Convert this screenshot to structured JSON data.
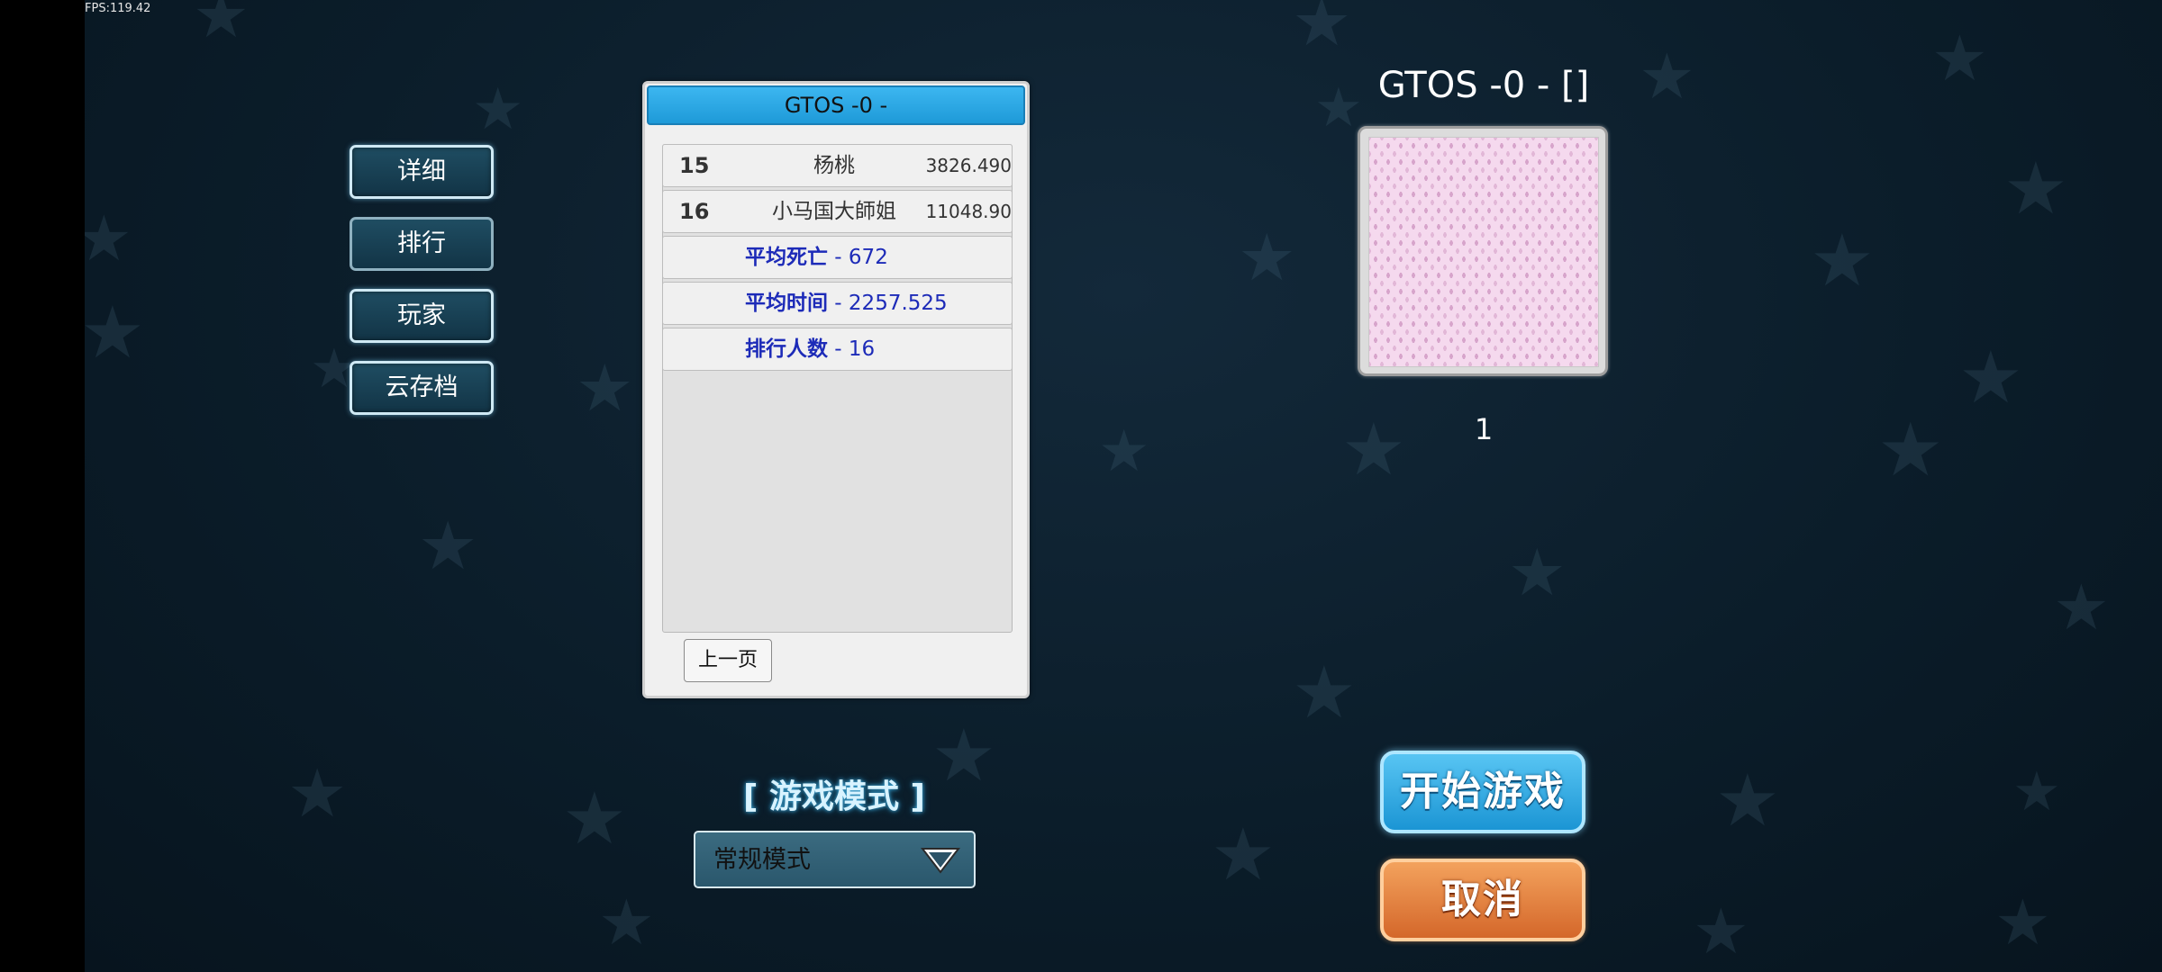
{
  "hud": {
    "fps": "FPS:119.42"
  },
  "menu": {
    "details": "详细",
    "ranking": "排行",
    "players": "玩家",
    "cloud_save": "云存档"
  },
  "leaderboard": {
    "title": "GTOS -0 -",
    "entries": [
      {
        "rank": "15",
        "name": "杨桃",
        "score": "3826.490"
      },
      {
        "rank": "16",
        "name": "小马国大師姐",
        "score": "11048.90"
      }
    ],
    "stats": [
      {
        "label": "平均死亡",
        "value": " - 672"
      },
      {
        "label": "平均时间",
        "value": " - 2257.525"
      },
      {
        "label": "排行人数",
        "value": " - 16"
      }
    ],
    "prev_page": "上一页"
  },
  "mode": {
    "title": "[ 游戏模式 ]",
    "selected": "常规模式"
  },
  "level": {
    "title": "GTOS -0 - []",
    "count": "1"
  },
  "actions": {
    "start": "开始游戏",
    "cancel": "取消"
  },
  "colors": {
    "start_button": "#1b95d4",
    "cancel_button": "#d4672a",
    "board_header": "#1e9ad8",
    "stat_text": "#1d2bb8"
  }
}
